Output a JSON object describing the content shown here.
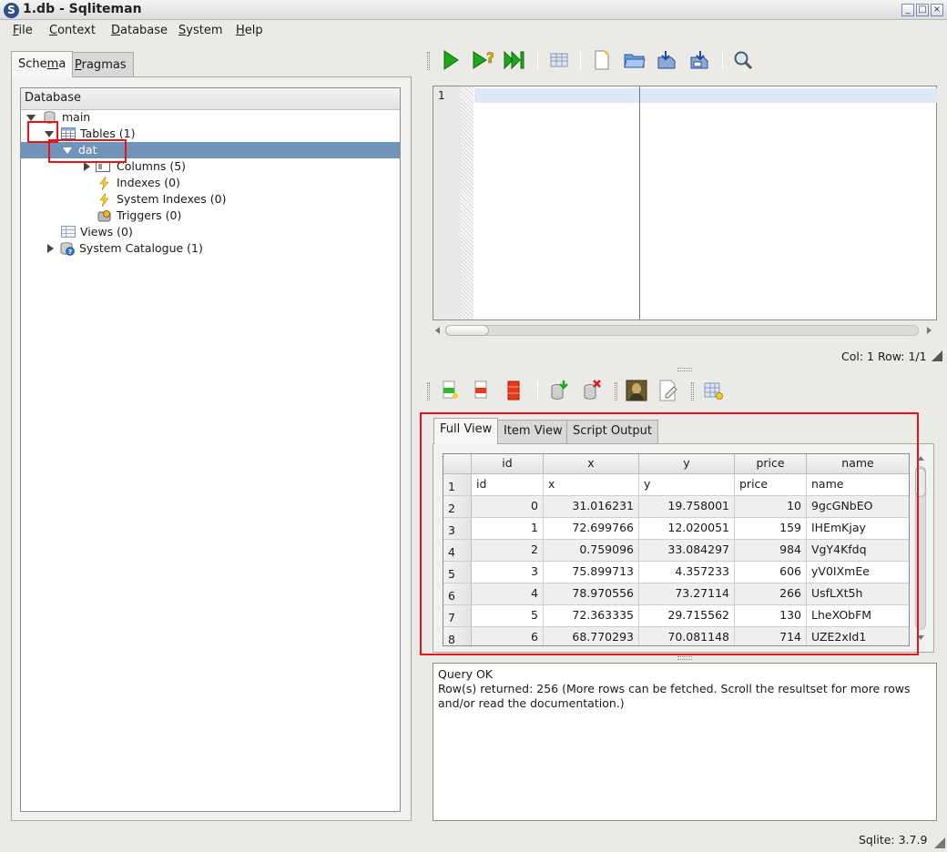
{
  "window": {
    "title": "1.db - Sqliteman",
    "app_icon": "S"
  },
  "menubar": {
    "items": [
      {
        "label": "File",
        "underline": "F",
        "rest": "ile"
      },
      {
        "label": "Context",
        "underline": "C",
        "rest": "ontext"
      },
      {
        "label": "Database",
        "underline": "D",
        "rest": "atabase"
      },
      {
        "label": "System",
        "underline": "S",
        "rest": "ystem"
      },
      {
        "label": "Help",
        "underline": "H",
        "rest": "elp"
      }
    ]
  },
  "left_tabs": [
    {
      "label_pre": "Sche",
      "underline": "m",
      "label_post": "a",
      "active": true
    },
    {
      "label_pre": "",
      "underline": "P",
      "label_post": "ragmas",
      "active": false
    }
  ],
  "tree": {
    "header": "Database",
    "nodes": [
      {
        "label": "main"
      },
      {
        "label": "Tables (1)"
      },
      {
        "label": "dat"
      },
      {
        "label": "Columns (5)"
      },
      {
        "label": "Indexes (0)"
      },
      {
        "label": "System Indexes (0)"
      },
      {
        "label": "Triggers (0)"
      },
      {
        "label": "Views (0)"
      },
      {
        "label": "System Catalogue (1)"
      }
    ]
  },
  "editor": {
    "line_number": "1"
  },
  "status": {
    "col_row": "Col: 1 Row: 1/1",
    "sqlite_version": "Sqlite: 3.7.9"
  },
  "result_tabs": [
    {
      "label": "Full View",
      "active": true
    },
    {
      "label": "Item View",
      "active": false
    },
    {
      "label": "Script Output",
      "active": false
    }
  ],
  "grid": {
    "columns": [
      "id",
      "x",
      "y",
      "price",
      "name"
    ],
    "row_numbers": [
      "1",
      "2",
      "3",
      "4",
      "5",
      "6",
      "7",
      "8"
    ],
    "rows": [
      [
        "id",
        "x",
        "y",
        "price",
        "name"
      ],
      [
        "0",
        "31.016231",
        "19.758001",
        "10",
        "9gcGNbEO"
      ],
      [
        "1",
        "72.699766",
        "12.020051",
        "159",
        "IHEmKjay"
      ],
      [
        "2",
        "0.759096",
        "33.084297",
        "984",
        "VgY4Kfdq"
      ],
      [
        "3",
        "75.899713",
        "4.357233",
        "606",
        "yV0IXmEe"
      ],
      [
        "4",
        "78.970556",
        "73.27114",
        "266",
        "UsfLXt5h"
      ],
      [
        "5",
        "72.363335",
        "29.715562",
        "130",
        "LheXObFM"
      ],
      [
        "6",
        "68.770293",
        "70.081148",
        "714",
        "UZE2xId1"
      ]
    ]
  },
  "message": {
    "line1": "Query OK",
    "line2": "Row(s) returned: 256 (More rows can be fetched. Scroll the resultset for more rows and/or read the documentation.)"
  },
  "colors": {
    "selection": "#6f93b9",
    "highlight_box": "#e8141a",
    "run_green": "#1ea81e"
  }
}
